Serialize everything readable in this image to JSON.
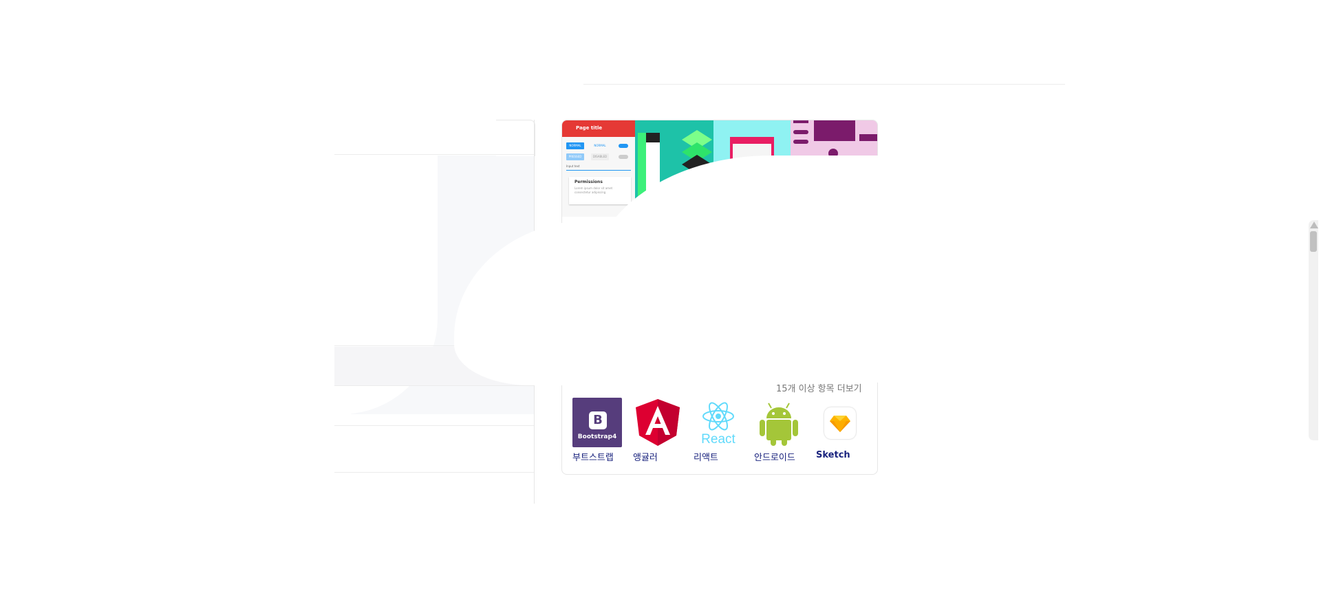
{
  "preview": {
    "app_title": "Page title",
    "chip_primary": "NORMAL",
    "chip_secondary": "PRESSED",
    "chip_tertiary": "NORMAL",
    "chip_quaternary": "DISABLED",
    "input_label": "Input text",
    "card_title": "Permissions",
    "card_text": "Lorem ipsum dolor sit amet consectetur adipiscing"
  },
  "more_link": "15개 이상 항목 더보기",
  "tools": [
    {
      "label": "부트스트랩",
      "icon": "bootstrap-icon",
      "logo_text": "Bootstrap4"
    },
    {
      "label": "앵귤러",
      "icon": "angular-icon"
    },
    {
      "label": "리액트",
      "icon": "react-icon",
      "logo_text": "React"
    },
    {
      "label": "안드로이드",
      "icon": "android-icon"
    },
    {
      "label": "Sketch",
      "icon": "sketch-icon"
    }
  ],
  "colors": {
    "link_label": "#1a237e",
    "bootstrap": "#563d7c",
    "angular": "#dd0031",
    "react": "#61dafb",
    "android": "#a4c639",
    "sketch": "#f7b500",
    "material_red": "#e53935"
  }
}
